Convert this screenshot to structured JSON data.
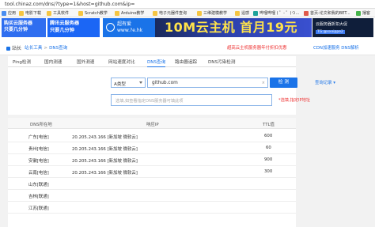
{
  "browser": {
    "url": "tool.chinaz.com/dns/?type=1&host=github.com&ip="
  },
  "bookmarks": [
    {
      "label": "应用",
      "icon": "apps-icon"
    },
    {
      "label": "电影下载",
      "icon": "folder-icon"
    },
    {
      "label": "工具软件",
      "icon": "folder-icon"
    },
    {
      "label": "Scratch教学",
      "icon": "folder-icon"
    },
    {
      "label": "Arduino教学",
      "icon": "folder-icon"
    },
    {
      "label": "电子元器件查询",
      "icon": "folder-icon"
    },
    {
      "label": "三维建模教学",
      "icon": "folder-icon"
    },
    {
      "label": "遥感",
      "icon": "folder-icon"
    },
    {
      "label": "哔哩哔哩 ( ゜- ゜)つ...",
      "icon": "bilibili-icon"
    },
    {
      "label": "首页-论文和我的BET...",
      "icon": "page-icon"
    },
    {
      "label": "播客",
      "icon": "page-icon"
    }
  ],
  "ads": {
    "ad1_line1": "购买云服务器",
    "ad1_line2": "只要几分钟",
    "ad2_line1": "腾讯云服务器",
    "ad2_line2": "只要几分钟",
    "ad3_line1": "超有爱",
    "ad3_line2": "www.?e.hk",
    "ad4_text": "10M云主机 首月19元",
    "ad5_line1": "云服务器折扣大促",
    "ad5_tag": "TG:@xxxippe2"
  },
  "site": {
    "brand": "站长",
    "crumbs": [
      "站长工具",
      "DNS查询"
    ],
    "notice_red": "超高云主机服务器年付折扣优惠",
    "notice_blue": "CDN加速服务 DNS解析"
  },
  "tabs": [
    "Ping检测",
    "国内测速",
    "国外测速",
    "网站速度对比",
    "DNS查询",
    "路由器追踪",
    "DNS污染检测"
  ],
  "active_tab": "DNS查询",
  "query": {
    "record_type": "A类型",
    "host_value": "github.com",
    "clear_label": "×",
    "button_label": "检 测",
    "records_link": "查询记录 ▾",
    "ip_placeholder": "选填,如查看指定DNS服务器可填此项",
    "ip_note": "*选填,指定IP地址"
  },
  "table": {
    "headers": [
      "DNS所在地",
      "响应IP",
      "TTL值"
    ],
    "rows": [
      {
        "location": "广东[电信]",
        "ip": "20.205.243.166 [新加坡 微软云]",
        "ttl": "600"
      },
      {
        "location": "贵州[电信]",
        "ip": "20.205.243.166 [新加坡 微软云]",
        "ttl": "60"
      },
      {
        "location": "安徽[电信]",
        "ip": "20.205.243.166 [新加坡 微软云]",
        "ttl": "900"
      },
      {
        "location": "云南[电信]",
        "ip": "20.205.243.166 [新加坡 微软云]",
        "ttl": "300"
      },
      {
        "location": "山东[联通]",
        "ip": "",
        "ttl": ""
      },
      {
        "location": "吉林[联通]",
        "ip": "",
        "ttl": ""
      },
      {
        "location": "江苏[联通]",
        "ip": "",
        "ttl": ""
      }
    ]
  }
}
